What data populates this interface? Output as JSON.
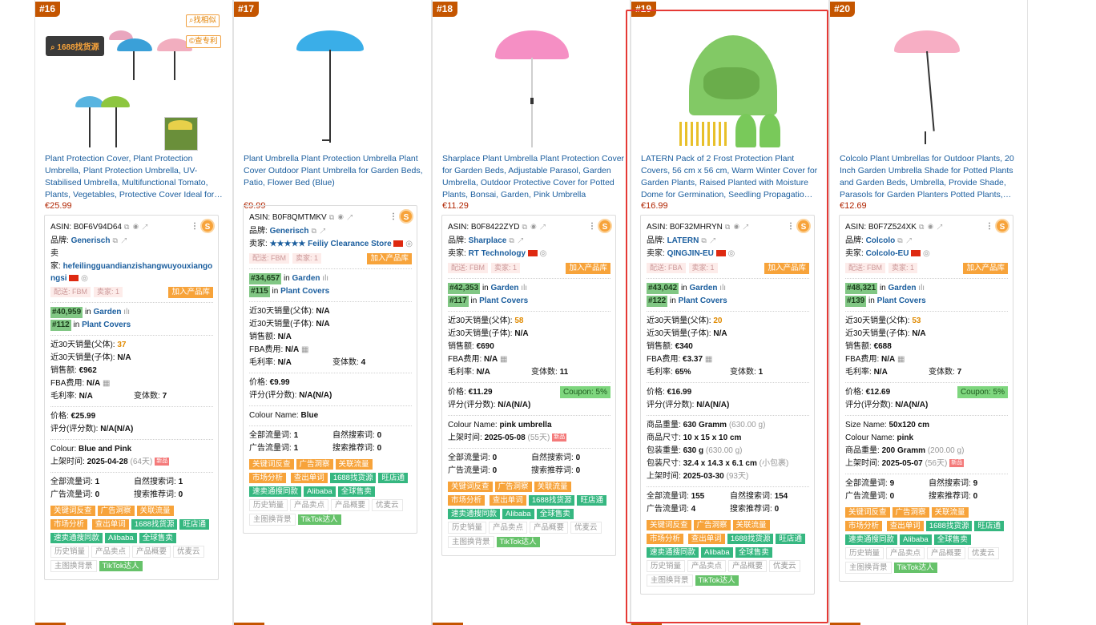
{
  "cards": [
    {
      "rank": "#16",
      "title": "Plant Protection Cover, Plant Protection Umbrella, Plant Protection Umbrella, UV-Stabilised Umbrella, Multifunctional Tomato, Plants, Vegetables, Protective Cover Ideal for…",
      "price": "€25.99",
      "asin": "ASIN: B0F6V94D64",
      "brand_label": "品牌:",
      "brand": "Generisch",
      "seller_label_1": "卖",
      "seller_label_2": "家:",
      "seller": "hefeilingguandianzishangwuyouxiangongsi",
      "ship_tag": "配送: FBM",
      "sellers_tag": "卖家: 1",
      "add_btn": "加入产品库",
      "rank1": "#40,959",
      "rank1_cat": "Garden",
      "rank2": "#112",
      "rank2_cat": "Plant Covers",
      "in": "in",
      "sales30_parent_label": "近30天销量(父体):",
      "sales30_parent": "37",
      "sales30_child_label": "近30天销量(子体):",
      "sales30_child": "N/A",
      "revenue_label": "销售额:",
      "revenue": "€962",
      "fba_label": "FBA费用:",
      "fba": "N/A",
      "margin_label": "毛利率:",
      "margin": "N/A",
      "variants_label": "变体数:",
      "variants": "7",
      "price_label": "价格:",
      "price2": "€25.99",
      "rating_label": "评分(评分数):",
      "rating": "N/A(N/A)",
      "attr_label": "Colour:",
      "attr_value": "Blue and Pink",
      "listed_label": "上架时间:",
      "listed": "2025-04-28",
      "listed_days": "(64天)",
      "new_badge": "新品",
      "traffic_all_label": "全部流量词:",
      "traffic_all": "1",
      "organic_label": "自然搜索词:",
      "organic": "1",
      "ad_label": "广告流量词:",
      "ad": "0",
      "rec_label": "搜索推荐词:",
      "rec": "0",
      "side_btn_1": "找相似",
      "side_btn_2": "查专利",
      "tooltip": "1688找货源"
    },
    {
      "rank": "#17",
      "title": "Plant Umbrella Plant Protection Umbrella Plant Cover Outdoor Plant Umbrella for Garden Beds, Patio, Flower Bed (Blue)",
      "price": "€9.99",
      "asin": "ASIN: B0F8QMTMKV",
      "brand_label": "品牌:",
      "brand": "Generisch",
      "seller_label": "卖家:",
      "seller": "★★★★★ Feiliy Clearance Store",
      "ship_tag": "配送: FBM",
      "sellers_tag": "卖家: 1",
      "add_btn": "加入产品库",
      "rank1": "#34,657",
      "rank1_cat": "Garden",
      "rank2": "#115",
      "rank2_cat": "Plant Covers",
      "in": "in",
      "sales30_parent_label": "近30天销量(父体):",
      "sales30_parent": "N/A",
      "sales30_child_label": "近30天销量(子体):",
      "sales30_child": "N/A",
      "revenue_label": "销售额:",
      "revenue": "N/A",
      "fba_label": "FBA费用:",
      "fba": "N/A",
      "margin_label": "毛利率:",
      "margin": "N/A",
      "variants_label": "变体数:",
      "variants": "4",
      "price_label": "价格:",
      "price2": "€9.99",
      "rating_label": "评分(评分数):",
      "rating": "N/A(N/A)",
      "attr_label": "Colour Name:",
      "attr_value": "Blue",
      "traffic_all_label": "全部流量词:",
      "traffic_all": "1",
      "organic_label": "自然搜索词:",
      "organic": "0",
      "ad_label": "广告流量词:",
      "ad": "1",
      "rec_label": "搜索推荐词:",
      "rec": "0"
    },
    {
      "rank": "#18",
      "title": "Sharplace Plant Umbrella Plant Protection Cover for Garden Beds, Adjustable Parasol, Garden Umbrella, Outdoor Protective Cover for Potted Plants, Bonsai, Garden, Pink Umbrella",
      "price": "€11.29",
      "asin": "ASIN: B0F8422ZYD",
      "brand_label": "品牌:",
      "brand": "Sharplace",
      "seller_label": "卖家:",
      "seller": "RT Technology",
      "ship_tag": "配送: FBM",
      "sellers_tag": "卖家: 1",
      "add_btn": "加入产品库",
      "rank1": "#42,353",
      "rank1_cat": "Garden",
      "rank2": "#117",
      "rank2_cat": "Plant Covers",
      "in": "in",
      "sales30_parent_label": "近30天销量(父体):",
      "sales30_parent": "58",
      "sales30_child_label": "近30天销量(子体):",
      "sales30_child": "N/A",
      "revenue_label": "销售额:",
      "revenue": "€690",
      "fba_label": "FBA费用:",
      "fba": "N/A",
      "margin_label": "毛利率:",
      "margin": "N/A",
      "variants_label": "变体数:",
      "variants": "11",
      "price_label": "价格:",
      "price2": "€11.29",
      "coupon": "Coupon: 5%",
      "rating_label": "评分(评分数):",
      "rating": "N/A(N/A)",
      "attr_label": "Colour Name:",
      "attr_value": "pink umbrella",
      "listed_label": "上架时间:",
      "listed": "2025-05-08",
      "listed_days": "(55天)",
      "new_badge": "新品",
      "traffic_all_label": "全部流量词:",
      "traffic_all": "0",
      "organic_label": "自然搜索词:",
      "organic": "0",
      "ad_label": "广告流量词:",
      "ad": "0",
      "rec_label": "搜索推荐词:",
      "rec": "0"
    },
    {
      "rank": "#19",
      "title": "LATERN Pack of 2 Frost Protection Plant Covers, 56 cm x 56 cm, Warm Winter Cover for Garden Plants, Raised Planted with Moisture Dome for Germination, Seedling Propagatio…",
      "price": "€16.99",
      "asin": "ASIN: B0F32MHRYN",
      "brand_label": "品牌:",
      "brand": "LATERN",
      "seller_label": "卖家:",
      "seller": "QINGJIN-EU",
      "ship_tag": "配送: FBA",
      "sellers_tag": "卖家: 1",
      "add_btn": "加入产品库",
      "rank1": "#43,042",
      "rank1_cat": "Garden",
      "rank2": "#122",
      "rank2_cat": "Plant Covers",
      "in": "in",
      "sales30_parent_label": "近30天销量(父体):",
      "sales30_parent": "20",
      "sales30_child_label": "近30天销量(子体):",
      "sales30_child": "N/A",
      "revenue_label": "销售额:",
      "revenue": "€340",
      "fba_label": "FBA费用:",
      "fba": "€3.37",
      "margin_label": "毛利率:",
      "margin": "65%",
      "variants_label": "变体数:",
      "variants": "1",
      "price_label": "价格:",
      "price2": "€16.99",
      "rating_label": "评分(评分数):",
      "rating": "N/A(N/A)",
      "weight_label": "商品重量:",
      "weight": "630 Gramm",
      "weight_g": "(630.00 g)",
      "size_label": "商品尺寸:",
      "size": "10 x 15 x 10 cm",
      "pkg_weight_label": "包装重量:",
      "pkg_weight": "630 g",
      "pkg_weight_g": "(630.00 g)",
      "pkg_size_label": "包装尺寸:",
      "pkg_size": "32.4 x 14.3 x 6.1 cm",
      "pkg_size_note": "(小包裹)",
      "listed_label": "上架时间:",
      "listed": "2025-03-30",
      "listed_days": "(93天)",
      "traffic_all_label": "全部流量词:",
      "traffic_all": "155",
      "organic_label": "自然搜索词:",
      "organic": "154",
      "ad_label": "广告流量词:",
      "ad": "4",
      "rec_label": "搜索推荐词:",
      "rec": "0"
    },
    {
      "rank": "#20",
      "title": "Colcolo Plant Umbrellas for Outdoor Plants, 20 Inch Garden Umbrella Shade for Potted Plants and Garden Beds, Umbrella, Provide Shade, Parasols for Garden Planters Potted Plants,…",
      "price": "€12.69",
      "asin": "ASIN: B0F7Z524XK",
      "brand_label": "品牌:",
      "brand": "Colcolo",
      "seller_label": "卖家:",
      "seller": "Colcolo-EU",
      "ship_tag": "配送: FBM",
      "sellers_tag": "卖家: 1",
      "add_btn": "加入产品库",
      "rank1": "#48,321",
      "rank1_cat": "Garden",
      "rank2": "#139",
      "rank2_cat": "Plant Covers",
      "in": "in",
      "sales30_parent_label": "近30天销量(父体):",
      "sales30_parent": "53",
      "sales30_child_label": "近30天销量(子体):",
      "sales30_child": "N/A",
      "revenue_label": "销售额:",
      "revenue": "€688",
      "fba_label": "FBA费用:",
      "fba": "N/A",
      "margin_label": "毛利率:",
      "margin": "N/A",
      "variants_label": "变体数:",
      "variants": "7",
      "price_label": "价格:",
      "price2": "€12.69",
      "coupon": "Coupon: 5%",
      "rating_label": "评分(评分数):",
      "rating": "N/A(N/A)",
      "size_label": "Size Name:",
      "size": "50x120 cm",
      "attr_label": "Colour Name:",
      "attr_value": "pink",
      "weight_label": "商品重量:",
      "weight": "200 Gramm",
      "weight_g": "(200.00 g)",
      "listed_label": "上架时间:",
      "listed": "2025-05-07",
      "listed_days": "(56天)",
      "new_badge": "新品",
      "traffic_all_label": "全部流量词:",
      "traffic_all": "9",
      "organic_label": "自然搜索词:",
      "organic": "9",
      "ad_label": "广告流量词:",
      "ad": "0",
      "rec_label": "搜索推荐词:",
      "rec": "0"
    }
  ],
  "tool_tags": {
    "keyword_reverse": "关键词反查",
    "ad_insight": "广告洞察",
    "related_traffic": "关联流量",
    "market_analysis": "市场分析",
    "single_word": "查出单词",
    "source_1688": "1688找货源",
    "wangwang": "旺店通",
    "speed_same": "速卖通搜同款",
    "alibaba": "Alibaba",
    "global_sale": "全球售卖",
    "history_sales": "历史销量",
    "product_points": "产品卖点",
    "product_overview": "产品概要",
    "youmaiyun": "优麦云",
    "main_image_bg": "主图换背景",
    "tiktok": "TikTok达人"
  },
  "icons": {
    "flag": "china-flag-icon",
    "chart": "bar-chart-icon",
    "calc": "calculator-icon",
    "menu": "more-icon",
    "badge": "s-logo-icon"
  },
  "colors": {
    "accent_orange": "#f7a33a",
    "rank_bg": "#c45500",
    "link_blue": "#1b5e9e",
    "price_red": "#b12704",
    "highlight_red": "#e53935"
  }
}
